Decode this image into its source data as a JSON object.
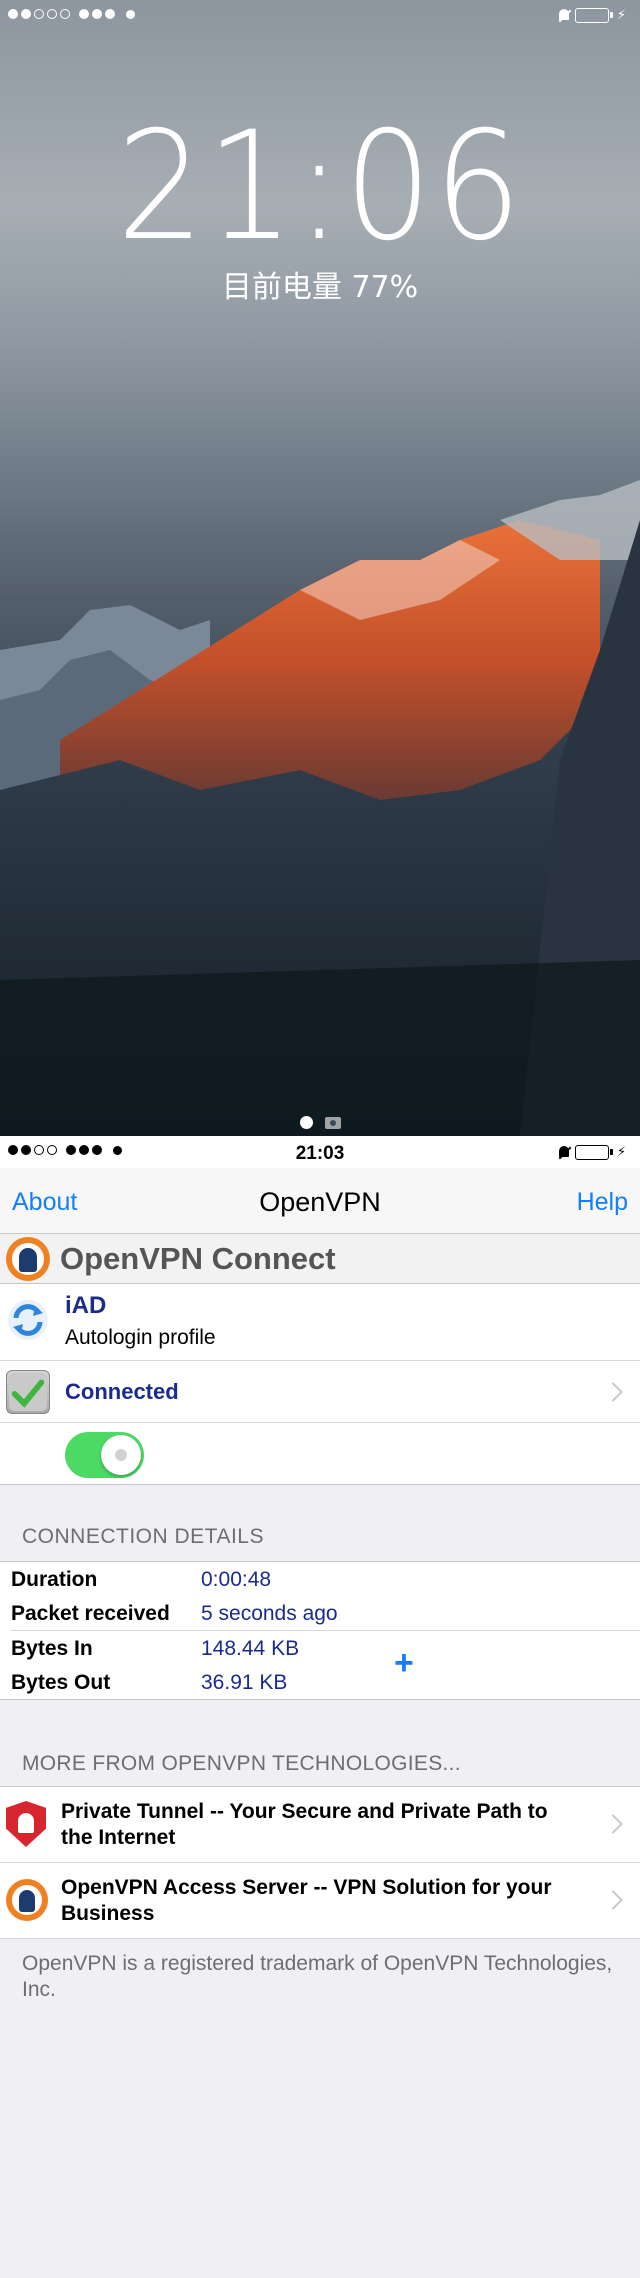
{
  "lock_screen": {
    "time": "21:06",
    "charge_text": "目前电量 77%",
    "battery_percent": 77
  },
  "app_status_bar": {
    "time": "21:03"
  },
  "navbar": {
    "left": "About",
    "title": "OpenVPN",
    "right": "Help"
  },
  "brand": {
    "title": "OpenVPN Connect"
  },
  "profile": {
    "name": "iAD",
    "subtitle": "Autologin profile"
  },
  "connection": {
    "status": "Connected",
    "toggle_on": true
  },
  "details": {
    "header": "CONNECTION DETAILS",
    "rows": [
      {
        "key": "Duration",
        "value": "0:00:48"
      },
      {
        "key": "Packet received",
        "value": "5 seconds ago"
      },
      {
        "key": "Bytes In",
        "value": "148.44 KB"
      },
      {
        "key": "Bytes Out",
        "value": "36.91 KB"
      }
    ],
    "plus": "+"
  },
  "more": {
    "header": "MORE FROM OPENVPN TECHNOLOGIES...",
    "items": [
      {
        "label": "Private Tunnel -- Your Secure and Private Path to the Internet",
        "icon": "private-tunnel-shield-icon"
      },
      {
        "label": "OpenVPN Access Server -- VPN Solution for your Business",
        "icon": "openvpn-logo-icon"
      }
    ]
  },
  "footer": "OpenVPN is a registered trademark of OpenVPN Technologies, Inc.",
  "colors": {
    "accent": "#157efb",
    "toggle_on": "#4cd964",
    "value_text": "#1a2b8c",
    "brand_orange": "#f08122"
  }
}
